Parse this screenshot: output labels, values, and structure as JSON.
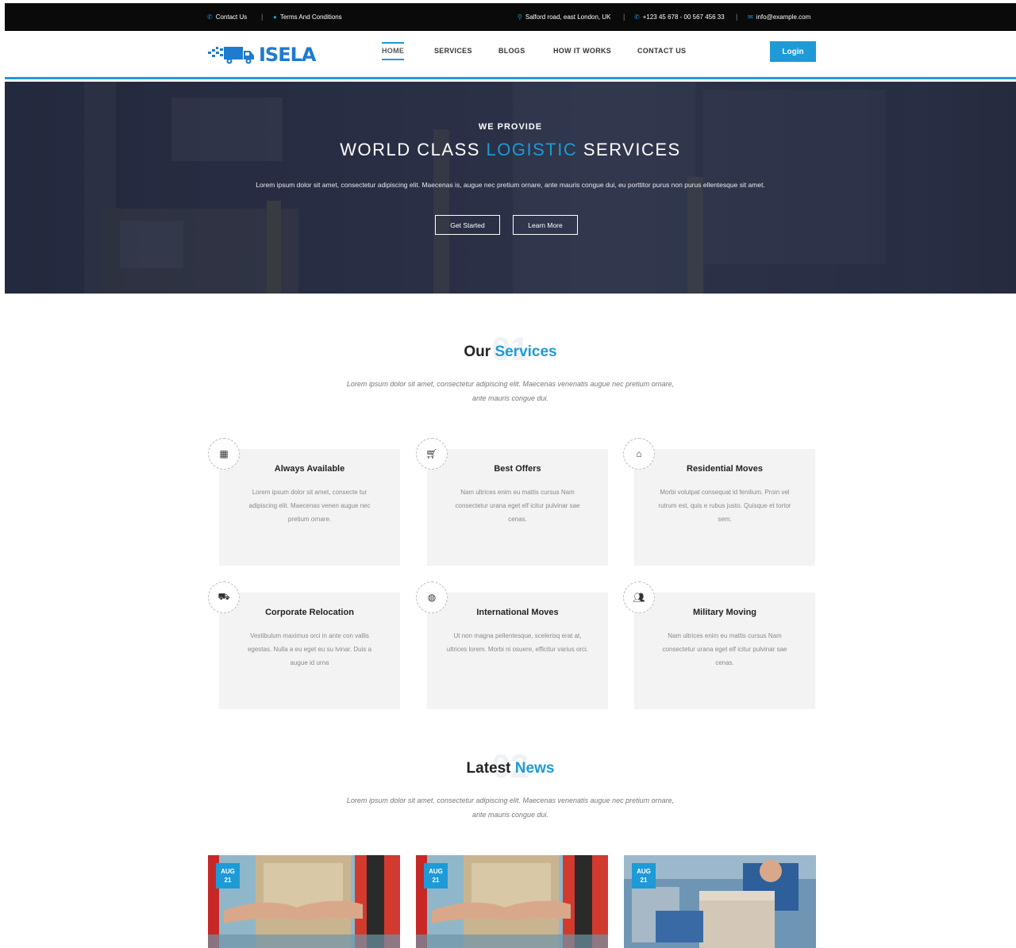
{
  "topbar": {
    "contact": "Contact Us",
    "terms": "Terms And Conditions",
    "address": "Salford road, east London, UK",
    "phone": "+123 45 678 - 00 567 456 33",
    "email": "info@example.com"
  },
  "brand": {
    "name": "ISELA"
  },
  "nav": {
    "items": [
      "HOME",
      "SERVICES",
      "BLOGS",
      "HOW IT WORKS",
      "CONTACT US"
    ],
    "login": "Login"
  },
  "hero": {
    "eyebrow": "WE PROVIDE",
    "title_before": "WORLD CLASS ",
    "title_accent": "LOGISTIC",
    "title_after": " SERVICES",
    "lede": "Lorem ipsum dolor sit amet, consectetur adipiscing elit. Maecenas is, augue nec pretium ornare, ante mauris congue dui, eu porttitor purus non purus ellentesque sit amet.",
    "btn_primary": "Get Started",
    "btn_secondary": "Learn More"
  },
  "services": {
    "bgnum": "01",
    "title_before": "Our ",
    "title_accent": "Services",
    "subtitle": "Lorem ipsum dolor sit amet, consectetur adipiscing elit. Maecenas venenatis augue nec pretium ornare, ante mauris congue dui.",
    "cards": [
      {
        "icon": "calendar-icon",
        "title": "Always Available",
        "text": "Lorem ipsum dolor sit amet, consecte tur adipiscing elit. Maecenas venen augue nec pretium ornare."
      },
      {
        "icon": "cart-icon",
        "title": "Best Offers",
        "text": "Nam ultrices enim eu mattis cursus Nam consectetur urana eget elf icitur pulvinar sae cenas."
      },
      {
        "icon": "home-icon",
        "title": "Residential Moves",
        "text": "Morbi volutpat consequat id fenilium. Proin vel rutrum est, quis e rubus justo. Quisque et tortor sem."
      },
      {
        "icon": "truck-icon",
        "title": "Corporate Relocation",
        "text": "Vestibulum maximus orci in ante con vallis egestas. Nulla a eu eget eu su lvinar. Duis a augue id urna"
      },
      {
        "icon": "globe-icon",
        "title": "International Moves",
        "text": "Ut non magna pellentesque, scelerisq erat at, ultrices lorem. Morbi ni osuere, efficitur varius orci."
      },
      {
        "icon": "users-icon",
        "title": "Military Moving",
        "text": "Nam ultrices enim eu mattis cursus Nam consectetur urana eget elf icitur pulvinar sae cenas."
      }
    ]
  },
  "news": {
    "bgnum": "02",
    "title_before": "Latest ",
    "title_accent": "News",
    "subtitle": "Lorem ipsum dolor sit amet, consectetur adipiscing elit. Maecenas venenatis augue nec pretium ornare, ante mauris congue dui.",
    "items": [
      {
        "month": "AUG",
        "day": "21"
      },
      {
        "month": "AUG",
        "day": "21"
      },
      {
        "month": "AUG",
        "day": "21"
      }
    ]
  },
  "colors": {
    "accent": "#1e9ad6",
    "topbar": "#0a0a0a",
    "card": "#f3f3f3"
  }
}
